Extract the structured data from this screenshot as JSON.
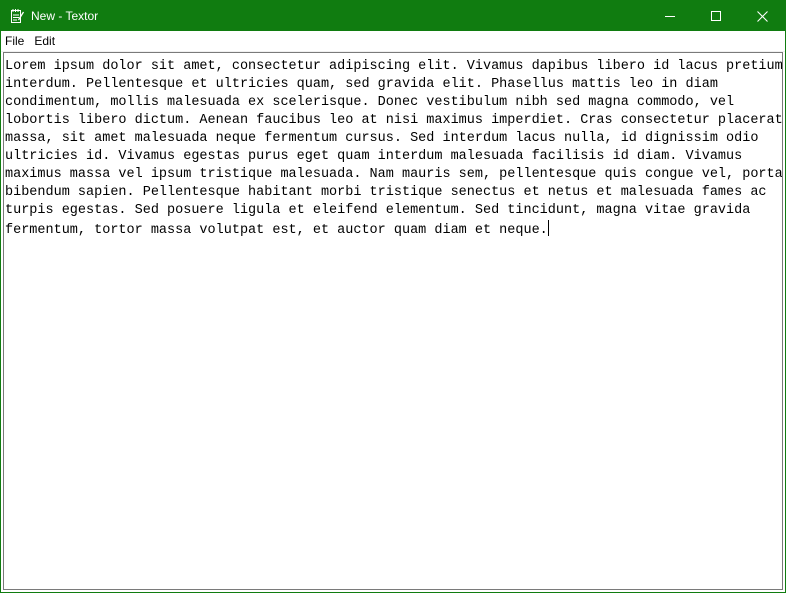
{
  "window": {
    "title": "New - Textor",
    "accent_color": "#107c10",
    "controls": [
      "minimize-icon",
      "maximize-icon",
      "close-icon"
    ]
  },
  "menu": {
    "file": "File",
    "edit": "Edit"
  },
  "editor": {
    "lines": [
      "Lorem ipsum dolor sit amet, consectetur adipiscing elit. Vivamus dapibus libero id lacus pretium",
      "interdum. Pellentesque et ultricies quam, sed gravida elit. Phasellus mattis leo in diam",
      "condimentum, mollis malesuada ex scelerisque. Donec vestibulum nibh sed magna commodo, vel",
      "lobortis libero dictum. Aenean faucibus leo at nisi maximus imperdiet. Cras consectetur placerat",
      "massa, sit amet malesuada neque fermentum cursus. Sed interdum lacus nulla, id dignissim odio",
      "ultricies id. Vivamus egestas purus eget quam interdum malesuada facilisis id diam. Vivamus",
      "maximus massa vel ipsum tristique malesuada. Nam mauris sem, pellentesque quis congue vel, porta",
      "bibendum sapien. Pellentesque habitant morbi tristique senectus et netus et malesuada fames ac",
      "turpis egestas. Sed posuere ligula et eleifend elementum. Sed tincidunt, magna vitae gravida",
      "fermentum, tortor massa volutpat est, et auctor quam diam et neque."
    ]
  }
}
